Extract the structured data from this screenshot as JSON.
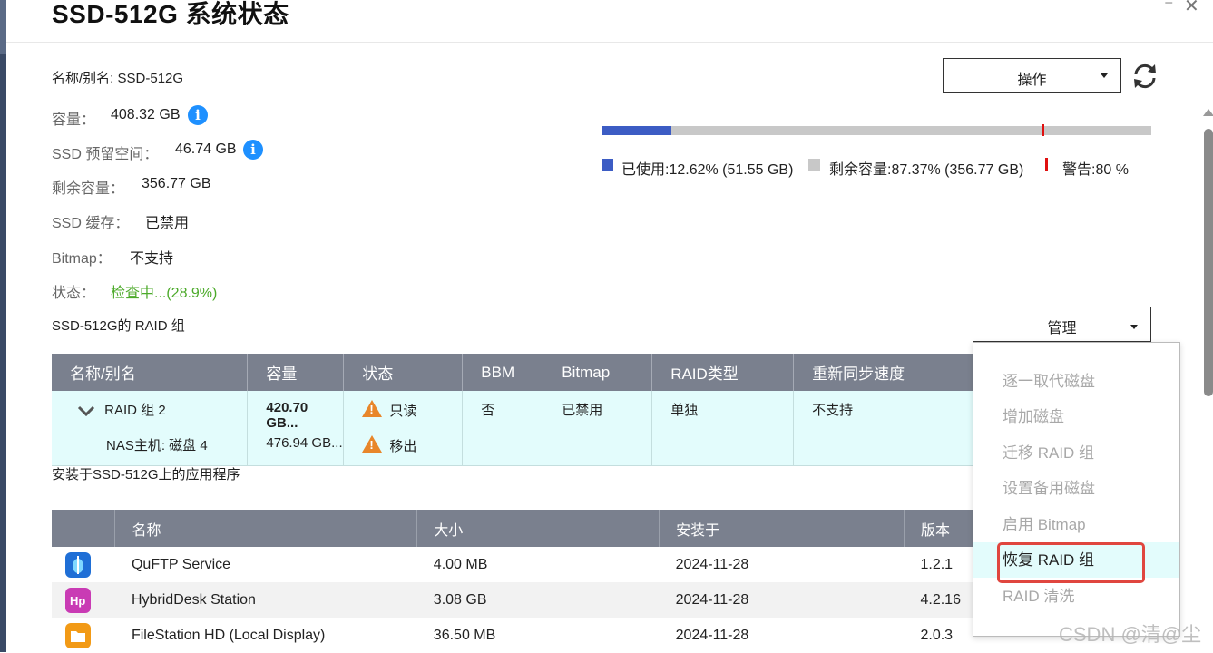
{
  "window": {
    "title": "SSD-512G  系统状态",
    "min_label": "⁻",
    "close_label": "✕"
  },
  "info": {
    "name_label": "名称/别名:",
    "name_value": "SSD-512G",
    "capacity_label": "容量：",
    "capacity_value": "408.32 GB",
    "reserved_label": "SSD 预留空间：",
    "reserved_value": "46.74 GB",
    "free_label": "剩余容量：",
    "free_value": "356.77 GB",
    "cache_label": "SSD 缓存：",
    "cache_value": "已禁用",
    "bitmap_label": "Bitmap：",
    "bitmap_value": "不支持",
    "status_label": "状态：",
    "status_value": "检查中...(28.9%)",
    "info_icon_glyph": "i"
  },
  "actions": {
    "operate_label": "操作",
    "manage_label": "管理"
  },
  "usage": {
    "used_fraction": 0.1262,
    "warning_fraction": 0.8,
    "used_text": "已使用:12.62% (51.55 GB)",
    "free_text": "剩余容量:87.37% (356.77 GB)",
    "warning_text": "警告:80 %",
    "colors": {
      "used": "#3c5cc4",
      "free": "#c8c8c8",
      "warning": "#e01010"
    }
  },
  "raid": {
    "section_title": "SSD-512G的 RAID 组",
    "headers": [
      "名称/别名",
      "容量",
      "状态",
      "BBM",
      "Bitmap",
      "RAID类型",
      "重新同步速度"
    ],
    "group": {
      "name": "RAID 组 2",
      "capacity": "420.70 GB...",
      "status": "只读",
      "bbm": "否",
      "bitmap": "已禁用",
      "type": "单独",
      "resync": "不支持"
    },
    "disk": {
      "name": "NAS主机: 磁盘 4",
      "capacity": "476.94 GB...",
      "status": "移出"
    }
  },
  "apps": {
    "section_title": "安装于SSD-512G上的应用程序",
    "headers": [
      "名称",
      "大小",
      "安装于",
      "版本"
    ],
    "rows": [
      {
        "icon": "quftp-icon",
        "name": "QuFTP Service",
        "size": "4.00 MB",
        "installed": "2024-11-28",
        "version": "1.2.1"
      },
      {
        "icon": "hybriddesk-icon",
        "name": "HybridDesk Station",
        "size": "3.08 GB",
        "installed": "2024-11-28",
        "version": "4.2.16"
      },
      {
        "icon": "filestation-icon",
        "name": "FileStation HD (Local Display)",
        "size": "36.50 MB",
        "installed": "2024-11-28",
        "version": "2.0.3"
      }
    ]
  },
  "menu": {
    "items": [
      "逐一取代磁盘",
      "增加磁盘",
      "迁移 RAID 组",
      "设置备用磁盘",
      "启用 Bitmap",
      "恢复 RAID 组",
      "RAID 清洗"
    ],
    "active_index": 5
  },
  "watermark": "CSDN @清@尘"
}
